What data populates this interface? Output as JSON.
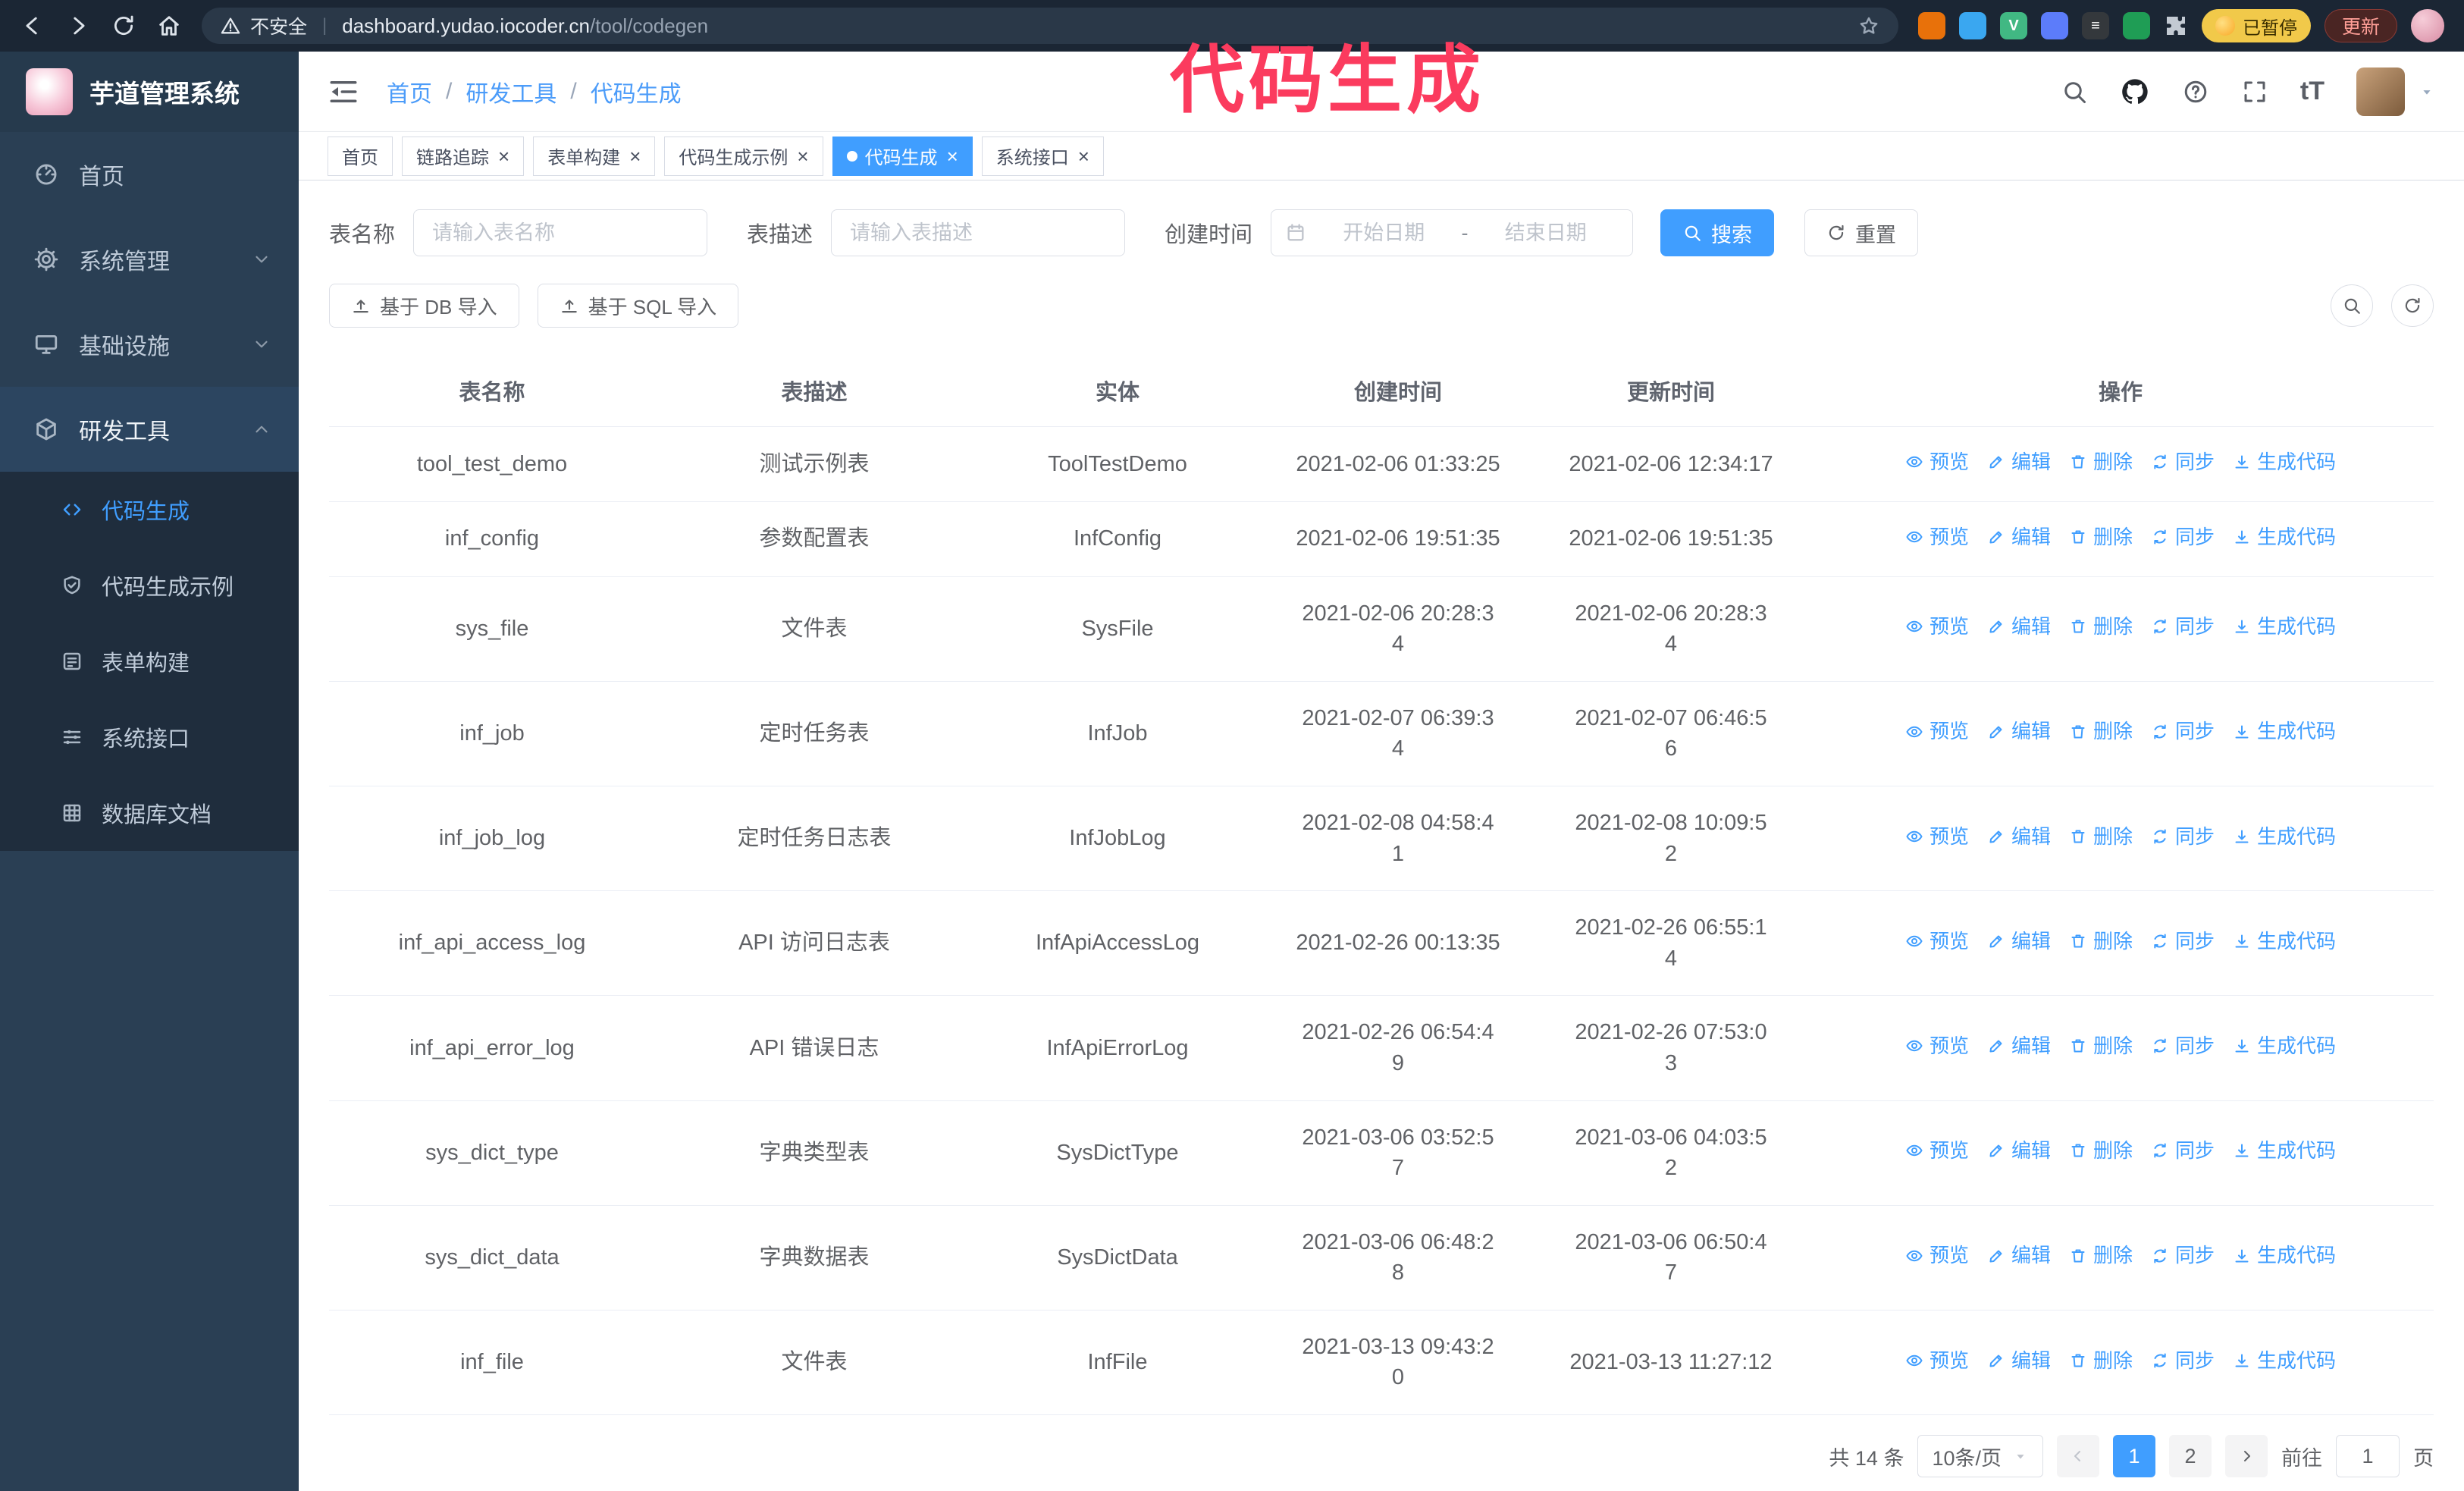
{
  "accent_color": "#409eff",
  "browser": {
    "security_label": "不安全",
    "url_host": "dashboard.yudao.iocoder.cn",
    "url_path": "/tool/codegen",
    "extensions": [
      {
        "color": "#e8710a"
      },
      {
        "color": "#3aa7f0"
      },
      {
        "color": "#41b883",
        "label": "V"
      },
      {
        "color": "#5c7cfa"
      },
      {
        "color": "#34383c",
        "label": "≡"
      },
      {
        "color": "#1f9d55"
      }
    ],
    "paused_badge": "已暂停",
    "update_button": "更新"
  },
  "annotation": {
    "text": "代码生成",
    "color": "#fb3b5e"
  },
  "sidebar": {
    "logo_title": "芋道管理系统",
    "menu": [
      {
        "key": "home",
        "label": "首页",
        "icon": "dashboard-icon"
      },
      {
        "key": "system",
        "label": "系统管理",
        "icon": "gear-icon",
        "chevron": "down"
      },
      {
        "key": "infra",
        "label": "基础设施",
        "icon": "monitor-icon",
        "chevron": "down"
      },
      {
        "key": "devtools",
        "label": "研发工具",
        "icon": "cube-icon",
        "chevron": "up",
        "active": true
      }
    ],
    "submenu": [
      {
        "key": "codegen",
        "label": "代码生成",
        "icon": "code-icon",
        "active": true
      },
      {
        "key": "codegen-demo",
        "label": "代码生成示例",
        "icon": "shield-icon"
      },
      {
        "key": "form-builder",
        "label": "表单构建",
        "icon": "form-icon"
      },
      {
        "key": "api",
        "label": "系统接口",
        "icon": "api-icon"
      },
      {
        "key": "db-doc",
        "label": "数据库文档",
        "icon": "grid-icon"
      }
    ]
  },
  "header": {
    "breadcrumb": [
      "首页",
      "研发工具",
      "代码生成"
    ]
  },
  "tabs": [
    {
      "label": "首页",
      "closable": false
    },
    {
      "label": "链路追踪",
      "closable": true
    },
    {
      "label": "表单构建",
      "closable": true
    },
    {
      "label": "代码生成示例",
      "closable": true
    },
    {
      "label": "代码生成",
      "closable": true,
      "active": true
    },
    {
      "label": "系统接口",
      "closable": true
    }
  ],
  "filters": {
    "name_label": "表名称",
    "name_placeholder": "请输入表名称",
    "desc_label": "表描述",
    "desc_placeholder": "请输入表描述",
    "time_label": "创建时间",
    "start_placeholder": "开始日期",
    "range_separator": "-",
    "end_placeholder": "结束日期",
    "search_button": "搜索",
    "reset_button": "重置"
  },
  "toolbar": {
    "import_db": "基于 DB 导入",
    "import_sql": "基于 SQL 导入"
  },
  "table": {
    "columns": [
      "表名称",
      "表描述",
      "实体",
      "创建时间",
      "更新时间",
      "操作"
    ],
    "actions": [
      {
        "name": "preview",
        "label": "预览",
        "icon": "eye-icon"
      },
      {
        "name": "edit",
        "label": "编辑",
        "icon": "edit-icon"
      },
      {
        "name": "delete",
        "label": "删除",
        "icon": "delete-icon"
      },
      {
        "name": "sync",
        "label": "同步",
        "icon": "sync-icon"
      },
      {
        "name": "generate-code",
        "label": "生成代码",
        "icon": "download-icon"
      }
    ],
    "rows": [
      {
        "name": "tool_test_demo",
        "desc": "测试示例表",
        "entity": "ToolTestDemo",
        "created": "2021-02-06 01:33:25",
        "updated": "2021-02-06 12:34:17"
      },
      {
        "name": "inf_config",
        "desc": "参数配置表",
        "entity": "InfConfig",
        "created": "2021-02-06 19:51:35",
        "updated": "2021-02-06 19:51:35"
      },
      {
        "name": "sys_file",
        "desc": "文件表",
        "entity": "SysFile",
        "created": "2021-02-06 20:28:3\n4",
        "updated": "2021-02-06 20:28:3\n4"
      },
      {
        "name": "inf_job",
        "desc": "定时任务表",
        "entity": "InfJob",
        "created": "2021-02-07 06:39:3\n4",
        "updated": "2021-02-07 06:46:5\n6"
      },
      {
        "name": "inf_job_log",
        "desc": "定时任务日志表",
        "entity": "InfJobLog",
        "created": "2021-02-08 04:58:4\n1",
        "updated": "2021-02-08 10:09:5\n2"
      },
      {
        "name": "inf_api_access_log",
        "desc": "API 访问日志表",
        "entity": "InfApiAccessLog",
        "created": "2021-02-26 00:13:35",
        "updated": "2021-02-26 06:55:1\n4"
      },
      {
        "name": "inf_api_error_log",
        "desc": "API 错误日志",
        "entity": "InfApiErrorLog",
        "created": "2021-02-26 06:54:4\n9",
        "updated": "2021-02-26 07:53:0\n3"
      },
      {
        "name": "sys_dict_type",
        "desc": "字典类型表",
        "entity": "SysDictType",
        "created": "2021-03-06 03:52:5\n7",
        "updated": "2021-03-06 04:03:5\n2"
      },
      {
        "name": "sys_dict_data",
        "desc": "字典数据表",
        "entity": "SysDictData",
        "created": "2021-03-06 06:48:2\n8",
        "updated": "2021-03-06 06:50:4\n7"
      },
      {
        "name": "inf_file",
        "desc": "文件表",
        "entity": "InfFile",
        "created": "2021-03-13 09:43:2\n0",
        "updated": "2021-03-13 11:27:12"
      }
    ]
  },
  "pagination": {
    "total": "共 14 条",
    "page_size": "10条/页",
    "pages": [
      "1",
      "2"
    ],
    "active_page": "1",
    "goto_label": "前往",
    "goto_value": "1",
    "page_suffix": "页"
  }
}
